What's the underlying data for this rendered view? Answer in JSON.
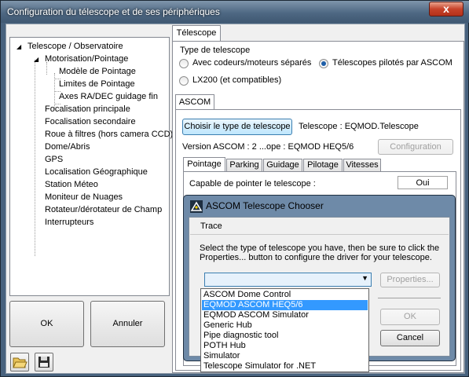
{
  "window": {
    "title": "Configuration du télescope et de ses périphériques",
    "close_label": "x"
  },
  "tree": {
    "items": [
      "Telescope / Observatoire",
      "Motorisation/Pointage",
      "Modèle de Pointage",
      "Limites de Pointage",
      "Axes RA/DEC guidage fin",
      "Focalisation principale",
      "Focalisation secondaire",
      "Roue à filtres (hors camera CCD)",
      "Dome/Abris",
      "GPS",
      "Localisation Géographique",
      "Station Méteo",
      "Moniteur de Nuages",
      "Rotateur/dérotateur de Champ",
      "Interrupteurs"
    ]
  },
  "buttons": {
    "ok": "OK",
    "cancel": "Annuler"
  },
  "tools": {
    "open": "folder-open-icon",
    "save": "floppy-disk-icon"
  },
  "telescope_tab": {
    "label": "Télescope",
    "group_title": "Type de telescope",
    "radio_separate": "Avec codeurs/moteurs séparés",
    "radio_ascom": "Télescopes pilotés par ASCOM",
    "radio_lx200": "LX200 (et compatibles)"
  },
  "ascom": {
    "tab_label": "ASCOM",
    "choose_button": "Choisir le type de telescope",
    "telescope_text": "Telescope :  EQMOD.Telescope",
    "version_text": "Version ASCOM : 2 ...ope : EQMOD HEQ5/6",
    "config_button": "Configuration",
    "subtabs": [
      "Pointage",
      "Parking",
      "Guidage",
      "Pilotage",
      "Vitesses"
    ],
    "capable_label": "Capable de pointer le telescope :",
    "capable_value": "Oui"
  },
  "chooser": {
    "title": "ASCOM Telescope Chooser",
    "trace_label": "Trace",
    "instructions_1": "Select the type of telescope you have, then be sure to click the",
    "instructions_2": "Properties... button to configure the driver for your telescope.",
    "properties_button": "Properties...",
    "ok_button": "OK",
    "cancel_button": "Cancel",
    "dropdown_items": [
      "ASCOM Dome Control",
      "EQMOD ASCOM HEQ5/6",
      "EQMOD ASCOM Simulator",
      "Generic Hub",
      "Pipe diagnostic tool",
      "POTH Hub",
      "Simulator",
      "Telescope Simulator for .NET"
    ],
    "selected_index": 1
  }
}
